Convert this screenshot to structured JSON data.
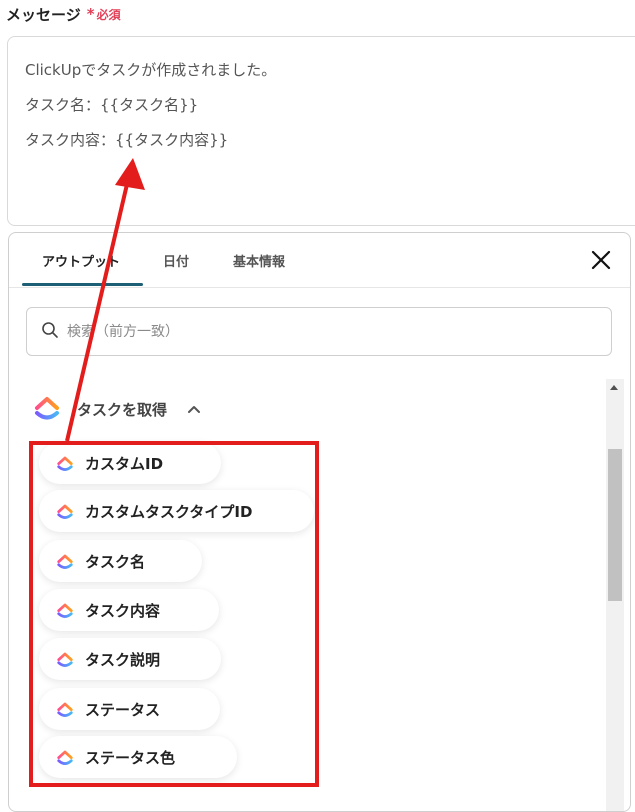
{
  "field": {
    "label": "メッセージ",
    "required_mark": "*",
    "required_text": "必須"
  },
  "message": {
    "lines": [
      "ClickUpでタスクが作成されました。",
      "タスク名：{{タスク名}}",
      "タスク内容：{{タスク内容}}"
    ]
  },
  "panel": {
    "tabs": [
      {
        "label": "アウトプット",
        "active": true
      },
      {
        "label": "日付",
        "active": false
      },
      {
        "label": "基本情報",
        "active": false
      }
    ],
    "search_placeholder": "検索（前方一致）",
    "group": {
      "title": "タスクを取得",
      "icon": "clickup-logo-icon",
      "items": [
        "カスタムID",
        "カスタムタスクタイプID",
        "タスク名",
        "タスク内容",
        "タスク説明",
        "ステータス",
        "ステータス色"
      ]
    }
  },
  "colors": {
    "required": "#e2415a",
    "annotation_red": "#e31c1c",
    "tab_underline": "#1d5f75"
  }
}
